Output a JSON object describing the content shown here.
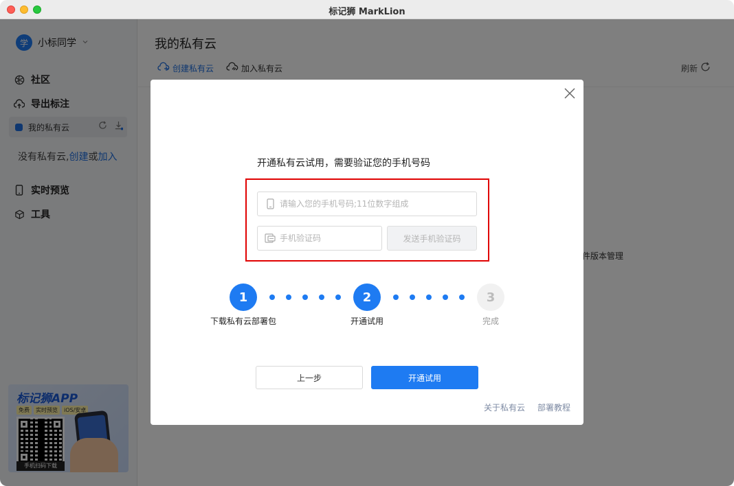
{
  "window": {
    "title": "标记狮 MarkLion"
  },
  "sidebar": {
    "user": {
      "avatar_text": "学",
      "name": "小标同学"
    },
    "nav": [
      {
        "label": "社区",
        "icon": "community-icon"
      },
      {
        "label": "导出标注",
        "icon": "upload-cloud-icon"
      }
    ],
    "cloud_item": {
      "label": "我的私有云"
    },
    "no_cloud": {
      "prefix": "没有私有云,",
      "create": "创建",
      "or": "或",
      "join": "加入"
    },
    "nav2": [
      {
        "label": "实时预览",
        "icon": "phone-icon"
      },
      {
        "label": "工具",
        "icon": "cube-icon"
      }
    ],
    "promo": {
      "title": "标记狮APP",
      "tags": [
        "免费",
        "实时预览",
        "iOS/安卓"
      ],
      "caption": "手机扫码下载"
    }
  },
  "main": {
    "title": "我的私有云",
    "tabs": [
      {
        "label": "创建私有云"
      },
      {
        "label": "加入私有云"
      }
    ],
    "refresh_label": "刷新",
    "bg_text": "件版本管理"
  },
  "modal": {
    "heading": "开通私有云试用，需要验证您的手机号码",
    "phone_placeholder": "请输入您的手机号码;11位数字组成",
    "code_placeholder": "手机验证码",
    "send_code_label": "发送手机验证码",
    "steps": [
      {
        "number": "1",
        "label": "下载私有云部署包"
      },
      {
        "number": "2",
        "label": "开通试用"
      },
      {
        "number": "3",
        "label": "完成"
      }
    ],
    "prev_label": "上一步",
    "next_label": "开通试用",
    "links": {
      "about": "关于私有云",
      "tutorial": "部署教程"
    }
  },
  "colors": {
    "accent": "#1e7bf2",
    "highlight_border": "#e00000"
  }
}
